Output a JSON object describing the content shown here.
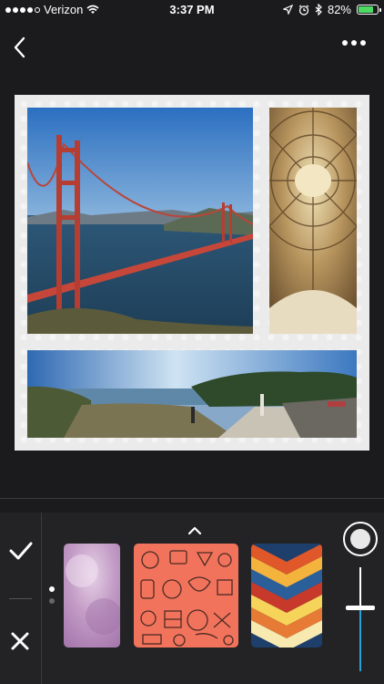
{
  "status_bar": {
    "carrier": "Verizon",
    "time": "3:37 PM",
    "battery_percent": "82%",
    "battery_level": 0.82,
    "signal_bars": 4,
    "icons": [
      "wifi-icon",
      "location-icon",
      "alarm-icon",
      "bluetooth-icon",
      "battery-icon"
    ]
  },
  "nav": {
    "back_icon": "chevron-left-icon",
    "more_icon": "ellipsis-icon"
  },
  "collage": {
    "photos": [
      {
        "subject": "golden-gate-bridge-photo"
      },
      {
        "subject": "rotunda-dome-photo"
      },
      {
        "subject": "coastal-panorama-photo"
      }
    ],
    "border_color": "#ebebeb"
  },
  "toolbar": {
    "confirm_icon": "checkmark-icon",
    "cancel_icon": "close-icon",
    "expand_icon": "chevron-up-icon",
    "backgrounds": [
      {
        "name": "watercolor-purple-pattern",
        "color": "#c9a6c8"
      },
      {
        "name": "doodle-orange-pattern",
        "color": "#f2735b"
      },
      {
        "name": "chevron-multicolor-pattern",
        "color": "#e0572a"
      }
    ],
    "page_indicator": {
      "current": 1,
      "total": 2
    },
    "slider": {
      "value": 0.38,
      "accent": "#2aa0d8"
    }
  }
}
